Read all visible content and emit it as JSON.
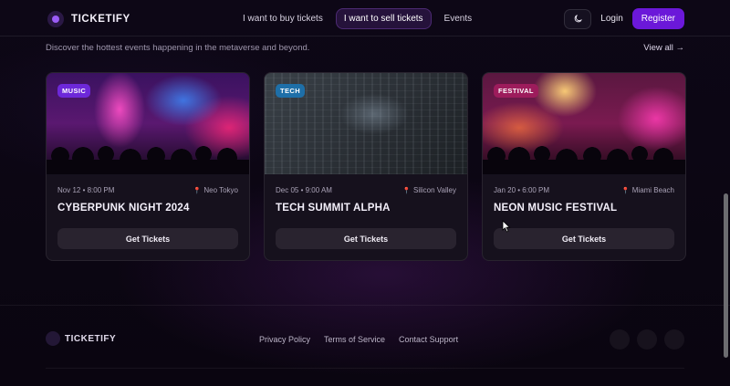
{
  "nav": {
    "brand": "TICKETIFY",
    "links": [
      "I want to buy tickets",
      "I want to sell tickets",
      "Events"
    ],
    "active_link": "I want to sell tickets",
    "theme_icon": "moon-icon",
    "login": "Login",
    "register": "Register"
  },
  "section": {
    "subtitle": "Discover the hottest events happening in the metaverse and beyond.",
    "view_all": "View all →"
  },
  "events": [
    {
      "category": "MUSIC",
      "category_color": "#6d28d9",
      "date": "Nov 12 • 8:00 PM",
      "location": "Neo Tokyo",
      "title": "CYBERPUNK NIGHT 2024",
      "button": "Get Tickets"
    },
    {
      "category": "TECH",
      "category_color": "#1e6fa8",
      "date": "Dec 05 • 9:00 AM",
      "location": "Silicon Valley",
      "title": "TECH SUMMIT ALPHA",
      "button": "Get Tickets"
    },
    {
      "category": "FESTIVAL",
      "category_color": "#9d1c5c",
      "date": "Jan 20 • 6:00 PM",
      "location": "Miami Beach",
      "title": "NEON MUSIC FESTIVAL",
      "button": "Get Tickets"
    }
  ],
  "footer": {
    "brand": "TICKETIFY",
    "links": [
      "Privacy Policy",
      "Terms of Service",
      "Contact Support"
    ]
  }
}
